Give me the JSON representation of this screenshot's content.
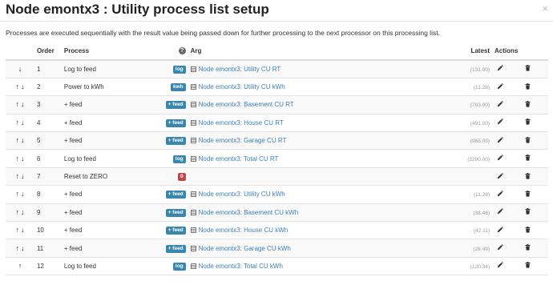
{
  "modal": {
    "title": "Node emontx3 : Utility process list setup",
    "close": "×",
    "intro": "Processes are executed sequentially with the result value being passed down for further processing to the next processor on this processing list."
  },
  "table": {
    "headers": {
      "order": "Order",
      "process": "Process",
      "help": "?",
      "arg": "Arg",
      "latest": "Latest",
      "actions": "Actions"
    },
    "rows": [
      {
        "up": false,
        "down": true,
        "order": "1",
        "process": "Log to feed",
        "badge": "log",
        "badge_color": "#3a87ad",
        "arg": "Node emontx3: Utility CU RT",
        "latest": "(131.00)"
      },
      {
        "up": true,
        "down": true,
        "order": "2",
        "process": "Power to kWh",
        "badge": "kwh",
        "badge_color": "#3a87ad",
        "arg": "Node emontx3: Utility CU kWh",
        "latest": "(11.28)"
      },
      {
        "up": true,
        "down": true,
        "order": "3",
        "process": "+ feed",
        "badge": "+ feed",
        "badge_color": "#3a87ad",
        "arg": "Node emontx3: Basement CU RT",
        "latest": "(703.00)"
      },
      {
        "up": true,
        "down": true,
        "order": "4",
        "process": "+ feed",
        "badge": "+ feed",
        "badge_color": "#3a87ad",
        "arg": "Node emontx3: House CU RT",
        "latest": "(491.00)"
      },
      {
        "up": true,
        "down": true,
        "order": "5",
        "process": "+ feed",
        "badge": "+ feed",
        "badge_color": "#3a87ad",
        "arg": "Node emontx3: Garage CU RT",
        "latest": "(965.00)"
      },
      {
        "up": true,
        "down": true,
        "order": "6",
        "process": "Log to feed",
        "badge": "log",
        "badge_color": "#3a87ad",
        "arg": "Node emontx3: Total CU RT",
        "latest": "(2290.00)"
      },
      {
        "up": true,
        "down": true,
        "order": "7",
        "process": "Reset to ZERO",
        "badge": "0",
        "badge_color": "#b94a48",
        "arg": "",
        "latest": ""
      },
      {
        "up": true,
        "down": true,
        "order": "8",
        "process": "+ feed",
        "badge": "+ feed",
        "badge_color": "#3a87ad",
        "arg": "Node emontx3: Utility CU kWh",
        "latest": "(11.28)"
      },
      {
        "up": true,
        "down": true,
        "order": "9",
        "process": "+ feed",
        "badge": "+ feed",
        "badge_color": "#3a87ad",
        "arg": "Node emontx3: Basement CU kWh",
        "latest": "(38.46)"
      },
      {
        "up": true,
        "down": true,
        "order": "10",
        "process": "+ feed",
        "badge": "+ feed",
        "badge_color": "#3a87ad",
        "arg": "Node emontx3: House CU kWh",
        "latest": "(42.11)"
      },
      {
        "up": true,
        "down": true,
        "order": "11",
        "process": "+ feed",
        "badge": "+ feed",
        "badge_color": "#3a87ad",
        "arg": "Node emontx3: Garage CU kWh",
        "latest": "(28.49)"
      },
      {
        "up": true,
        "down": false,
        "order": "12",
        "process": "Log to feed",
        "badge": "log",
        "badge_color": "#3a87ad",
        "arg": "Node emontx3: Total CU kWh",
        "latest": "(120.34)"
      }
    ]
  },
  "icons": {
    "up": "arrow-up-icon",
    "down": "arrow-down-icon",
    "feed": "feed-list-icon",
    "edit": "pencil-icon",
    "delete": "trash-icon",
    "help": "question-circle-icon"
  }
}
